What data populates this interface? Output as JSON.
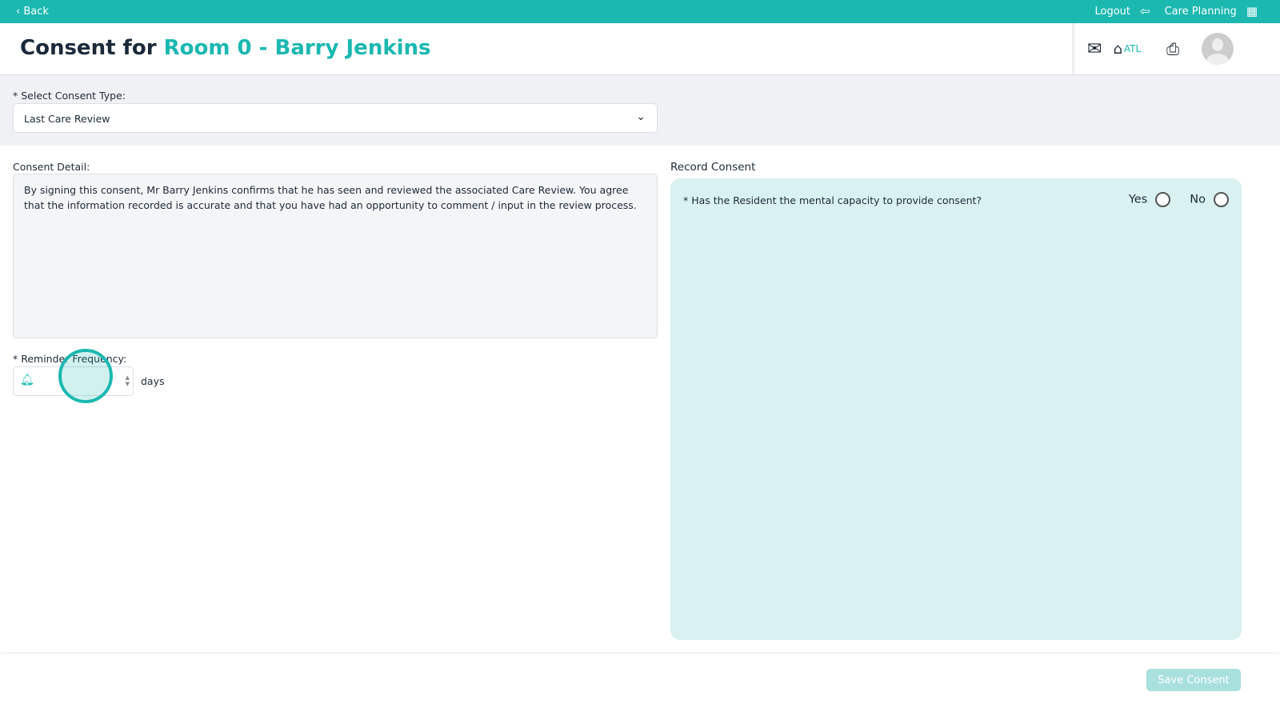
{
  "topbar": {
    "back": "‹ Back",
    "logout": "Logout",
    "app": "Care Planning"
  },
  "header": {
    "title_prefix": "Consent for",
    "title_subject": "Room 0 - Barry Jenkins",
    "home_label": "ATL"
  },
  "consent_type": {
    "label": "* Select Consent Type:",
    "value": "Last Care Review"
  },
  "detail": {
    "label": "Consent Detail:",
    "text": "By signing this consent, Mr Barry Jenkins confirms that he has seen and reviewed the associated Care Review.  You agree that the information recorded is accurate and that you have had an opportunity to comment / input in the review process."
  },
  "reminder": {
    "label": "* Reminder Frequency:",
    "value": "",
    "unit": "days"
  },
  "record": {
    "label": "Record Consent",
    "question": "* Has the Resident the mental capacity to provide consent?",
    "yes": "Yes",
    "no": "No"
  },
  "footer": {
    "save": "Save Consent"
  }
}
